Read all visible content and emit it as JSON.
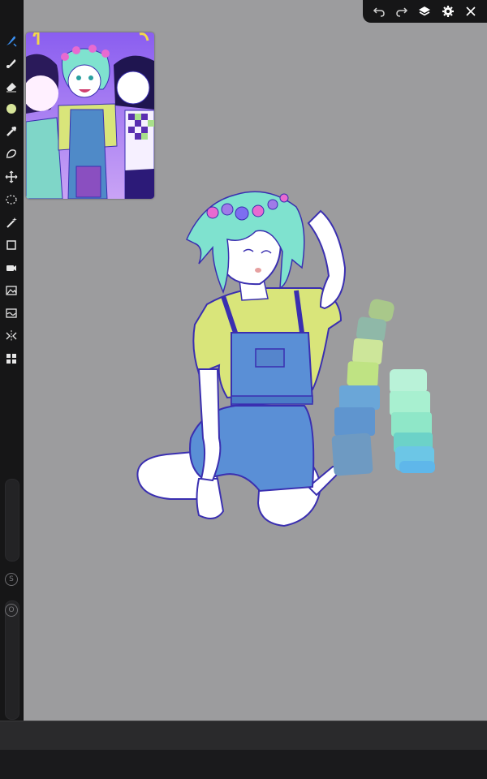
{
  "app": {
    "name": "",
    "canvas_color": "#9c9c9e",
    "toolbar_color": "#161617",
    "accent": "#3a8ff0"
  },
  "left_toolbar": {
    "tools": [
      {
        "name": "brush-tool-icon",
        "active": true
      },
      {
        "name": "smudge-tool-icon"
      },
      {
        "name": "eraser-tool-icon"
      },
      {
        "name": "color-swatch",
        "color": "#d7e59a"
      },
      {
        "name": "eyedropper-tool-icon"
      },
      {
        "name": "lasso-fill-tool-icon"
      },
      {
        "name": "transform-tool-icon"
      },
      {
        "name": "selection-tool-icon"
      },
      {
        "name": "magic-wand-tool-icon"
      },
      {
        "name": "shape-tool-icon"
      },
      {
        "name": "camera-tool-icon"
      },
      {
        "name": "image-import-tool-icon"
      },
      {
        "name": "adjustments-tool-icon"
      },
      {
        "name": "symmetry-tool-icon"
      },
      {
        "name": "layout-tool-icon"
      }
    ],
    "size_slider_label": "S",
    "opacity_slider_label": "O"
  },
  "top_toolbar": {
    "buttons": [
      "undo-icon",
      "redo-icon",
      "layers-icon",
      "settings-icon",
      "close-icon"
    ]
  },
  "reference_panel": {
    "visible": true
  },
  "swatches": {
    "column_1": [
      "#a9c88a",
      "#8fb8a8",
      "#cde69a",
      "#bfe383",
      "#6aa6d8",
      "#5f95cf",
      "#6e9ac2"
    ],
    "column_2": [
      "#b9f2d8",
      "#a8f0d0",
      "#8fe7c8",
      "#6cd2c8",
      "#6cc6e6",
      "#5fb7ea"
    ]
  }
}
